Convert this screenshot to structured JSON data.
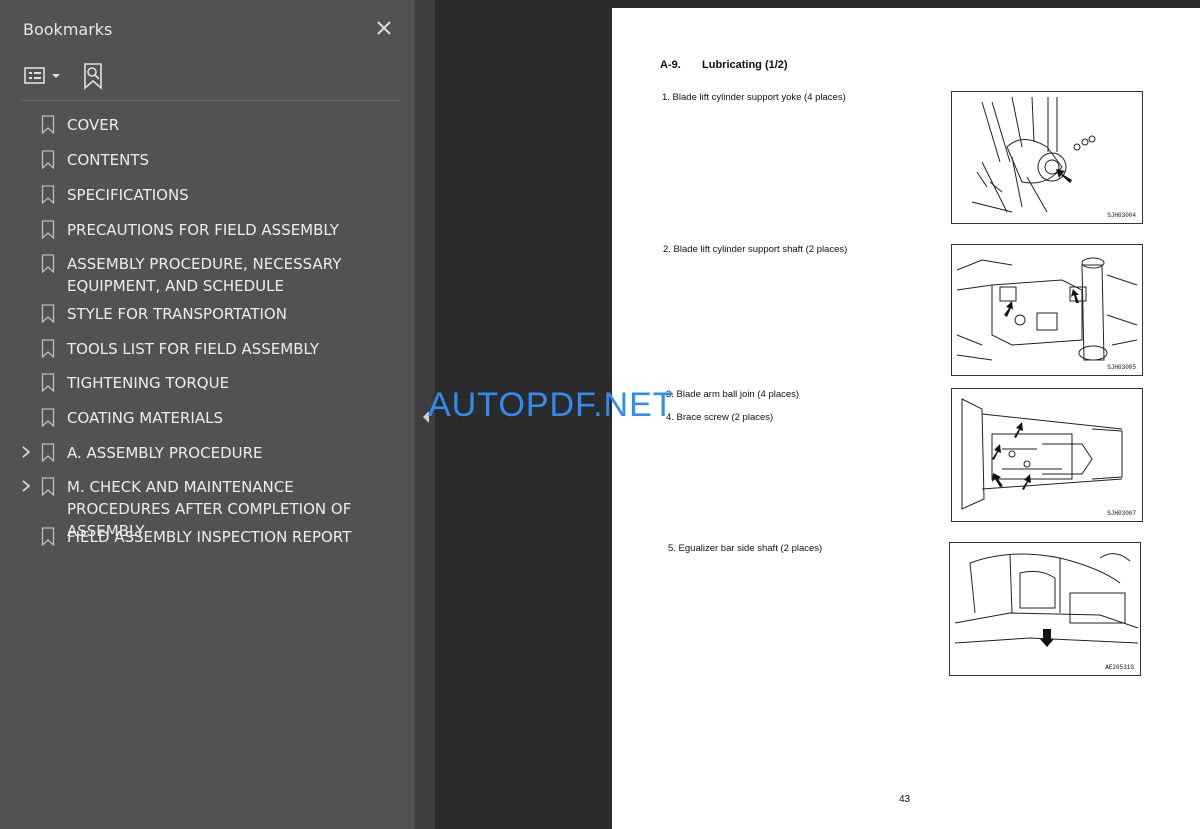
{
  "sidebar": {
    "title": "Bookmarks",
    "items": [
      {
        "label": "COVER",
        "expandable": false
      },
      {
        "label": "CONTENTS",
        "expandable": false
      },
      {
        "label": "SPECIFICATIONS",
        "expandable": false
      },
      {
        "label": "PRECAUTIONS FOR FIELD ASSEMBLY",
        "expandable": false
      },
      {
        "label": "ASSEMBLY PROCEDURE, NECESSARY EQUIPMENT, AND SCHEDULE",
        "expandable": false
      },
      {
        "label": "STYLE FOR TRANSPORTATION",
        "expandable": false
      },
      {
        "label": "TOOLS LIST FOR FIELD ASSEMBLY",
        "expandable": false
      },
      {
        "label": "TIGHTENING TORQUE",
        "expandable": false
      },
      {
        "label": "COATING MATERIALS",
        "expandable": false
      },
      {
        "label": "A. ASSEMBLY  PROCEDURE",
        "expandable": true
      },
      {
        "label": "M. CHECK AND MAINTENANCE PROCEDURES AFTER COMPLETION OF ASSEMBLY",
        "expandable": true
      },
      {
        "label": "FIELD ASSEMBLY INSPECTION REPORT",
        "expandable": false
      }
    ],
    "icons": [
      "close-icon",
      "options-icon",
      "find-bookmark-icon",
      "bookmark-ribbon-icon",
      "chevron-right-icon"
    ]
  },
  "watermark": "AUTOPDF.NET",
  "page": {
    "heading_num": "A-9.",
    "heading_title": "Lubricating (1/2)",
    "items": [
      "1. Blade lift cylinder support yoke (4 places)",
      "2. Blade lift cylinder support shaft (2 places)",
      "3. Blade arm ball join (4 places)",
      "4. Brace screw (2 places)",
      "5. Egualizer bar side shaft (2 places)"
    ],
    "figure_codes": [
      "SJH03004",
      "SJH03005",
      "SJH03007",
      "AE20531G"
    ],
    "page_number": "43"
  },
  "colors": {
    "sidebar_bg": "#525252",
    "viewer_bg": "#2b2b2b",
    "watermark": "#2f8cf5"
  }
}
